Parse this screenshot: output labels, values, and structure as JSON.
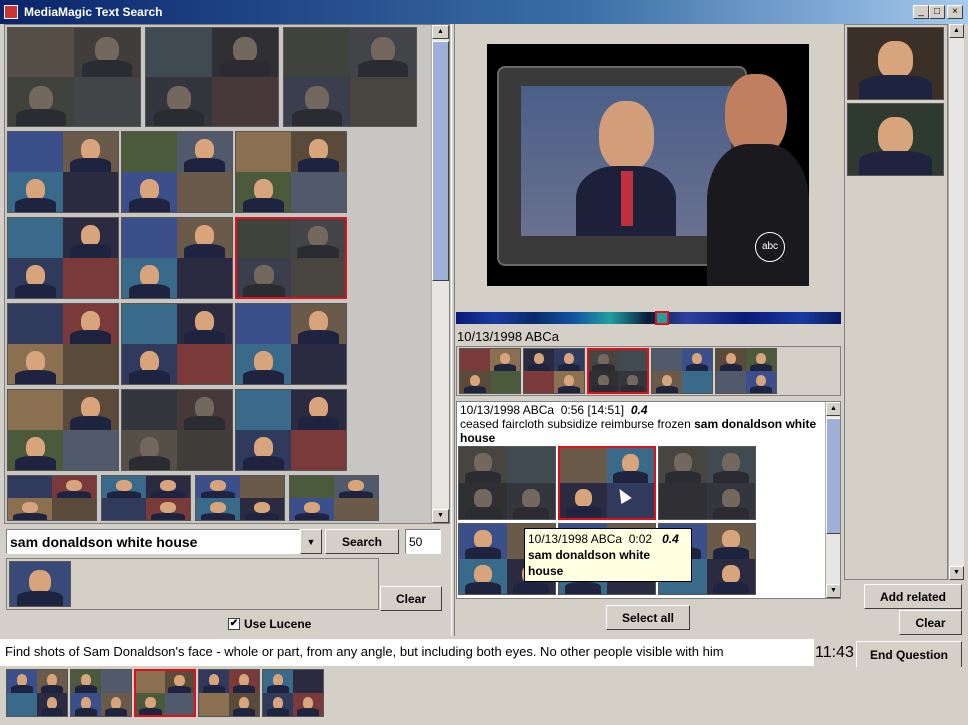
{
  "window": {
    "title": "MediaMagic Text Search",
    "controls": [
      "_",
      "□",
      "×"
    ]
  },
  "search": {
    "query": "sam donaldson white house",
    "search_label": "Search",
    "count": "50",
    "clear_label": "Clear",
    "use_lucene_label": "Use Lucene",
    "use_lucene_checked": true
  },
  "video": {
    "date_label": "10/13/1998 ABCa",
    "channel_logo": "abc"
  },
  "results": {
    "header_date": "10/13/1998 ABCa",
    "header_time": "0:56 [14:51]",
    "header_score": "0.4",
    "text_plain": "ceased faircloth subsidize reimburse frozen ",
    "text_bold": "sam donaldson white house",
    "tooltip": {
      "date": "10/13/1998 ABCa",
      "time": "0:02",
      "score": "0.4",
      "query": "sam donaldson white house"
    },
    "select_all_label": "Select all"
  },
  "right": {
    "add_related_label": "Add related",
    "clear_label": "Clear"
  },
  "task": {
    "question": "Find shots of Sam Donaldson's face - whole or part, from any angle, but including both eyes. No other people visible with him",
    "timer": "11:43",
    "end_label": "End Question"
  },
  "colors": {
    "selection": "#e0101a",
    "accent": "#0a246a"
  }
}
